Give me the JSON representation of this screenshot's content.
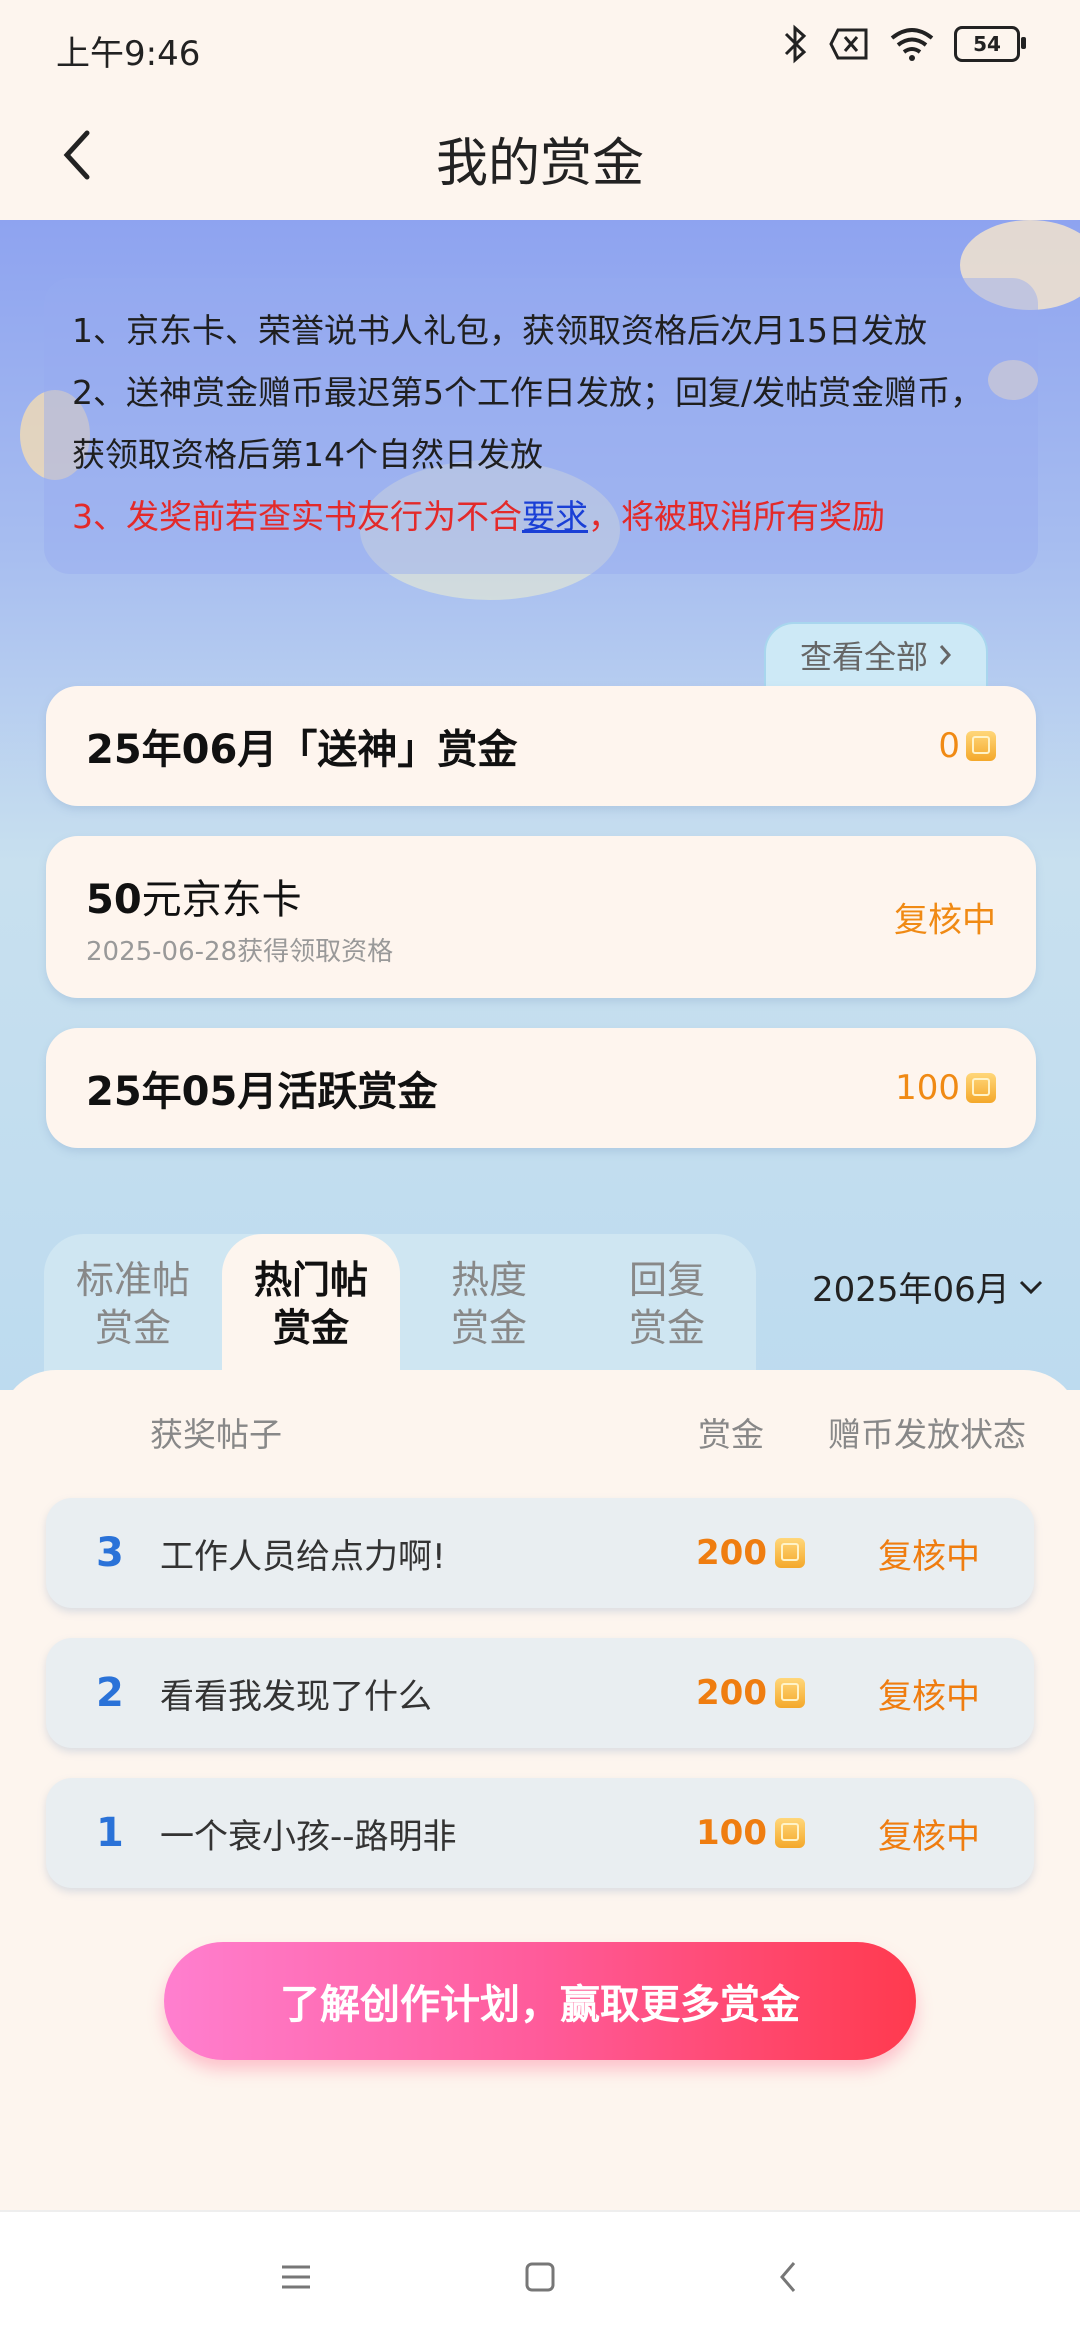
{
  "status_bar": {
    "time": "上午9:46",
    "battery": "54"
  },
  "header": {
    "title": "我的赏金"
  },
  "notice": {
    "line1": "1、京东卡、荣誉说书人礼包，获领取资格后次月15日发放",
    "line2": "2、送神赏金赠币最迟第5个工作日发放；回复/发帖赏金赠币，获领取资格后第14个自然日发放",
    "line3_prefix": "3、发奖前若查实书友行为不合",
    "line3_link": "要求",
    "line3_suffix": "，将被取消所有奖励"
  },
  "view_all": {
    "label": "查看全部"
  },
  "rewards": [
    {
      "title": "25年06月「送神」赏金",
      "value": "0",
      "has_coin": true
    },
    {
      "title_num": "50",
      "title_rest": "元京东卡",
      "subtitle": "2025-06-28获得领取资格",
      "status": "复核中"
    },
    {
      "title": "25年05月活跃赏金",
      "value": "100",
      "has_coin": true
    }
  ],
  "tabs": [
    {
      "line1": "标准帖",
      "line2": "赏金",
      "active": false
    },
    {
      "line1": "热门帖",
      "line2": "赏金",
      "active": true
    },
    {
      "line1": "热度",
      "line2": "赏金",
      "active": false
    },
    {
      "line1": "回复",
      "line2": "赏金",
      "active": false
    }
  ],
  "month_selector": {
    "value": "2025年06月"
  },
  "table": {
    "headers": {
      "post": "获奖帖子",
      "amount": "赏金",
      "status": "赠币发放状态"
    },
    "rows": [
      {
        "rank": "3",
        "title": "工作人员给点力啊!",
        "amount": "200",
        "status": "复核中"
      },
      {
        "rank": "2",
        "title": "看看我发现了什么",
        "amount": "200",
        "status": "复核中"
      },
      {
        "rank": "1",
        "title": "一个衰小孩--路明非",
        "amount": "100",
        "status": "复核中"
      }
    ]
  },
  "cta": {
    "label": "了解创作计划，赢取更多赏金"
  },
  "colors": {
    "accent_orange": "#ef7d10",
    "rank_blue": "#2a72d8",
    "notice_red": "#e32a2a",
    "cta_pink": "#ff5b9a"
  }
}
